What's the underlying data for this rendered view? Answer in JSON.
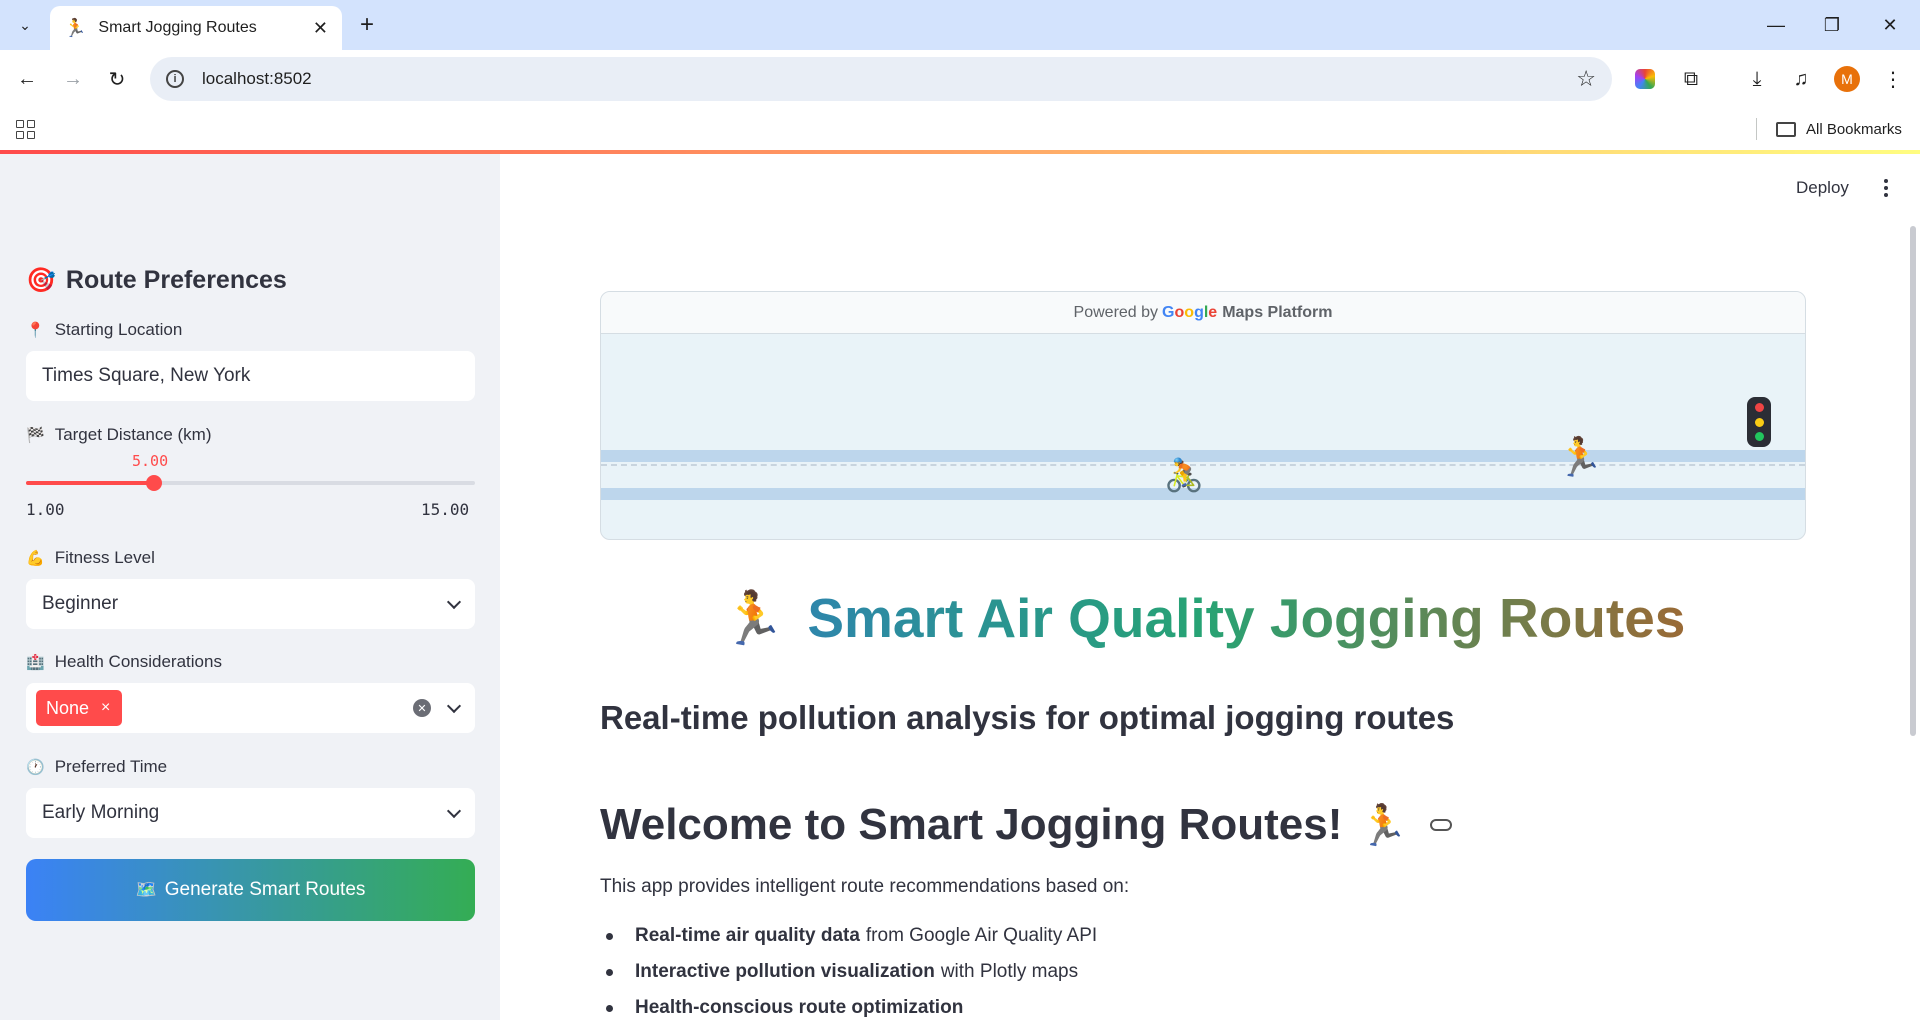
{
  "browser": {
    "tab_title": "Smart Jogging Routes",
    "tab_favicon": "🏃",
    "url": "localhost:8502",
    "profile_initial": "M",
    "bookmarks_label": "All Bookmarks"
  },
  "header": {
    "deploy_label": "Deploy"
  },
  "sidebar": {
    "title": "Route Preferences",
    "title_emoji": "🎯",
    "starting_location": {
      "label": "Starting Location",
      "emoji": "📍",
      "value": "Times Square, New York"
    },
    "target_distance": {
      "label": "Target Distance (km)",
      "emoji": "🏁",
      "value": "5.00",
      "min": "1.00",
      "max": "15.00",
      "fraction": 0.2857
    },
    "fitness_level": {
      "label": "Fitness Level",
      "emoji": "💪",
      "value": "Beginner"
    },
    "health_considerations": {
      "label": "Health Considerations",
      "emoji": "🏥",
      "chip": "None",
      "chip_remove": "×"
    },
    "preferred_time": {
      "label": "Preferred Time",
      "emoji": "🕐",
      "value": "Early Morning"
    },
    "generate_button": {
      "emoji": "🗺️",
      "label": "Generate Smart Routes"
    }
  },
  "banner": {
    "powered_by": "Powered by",
    "google_letters": [
      "G",
      "o",
      "o",
      "g",
      "l",
      "e"
    ],
    "google_colors": [
      "#4285F4",
      "#EA4335",
      "#FBBC05",
      "#4285F4",
      "#34A853",
      "#EA4335"
    ],
    "maps_platform": "Maps Platform",
    "bike_emoji": "🚴",
    "runner_emoji": "🏃",
    "traffic_light_colors": [
      "#ef4444",
      "#facc15",
      "#22c55e"
    ]
  },
  "main": {
    "title_emoji": "🏃",
    "title": "Smart Air Quality Jogging Routes",
    "subtitle": "Real-time pollution analysis for optimal jogging routes",
    "welcome": "Welcome to Smart Jogging Routes!",
    "welcome_emoji": "🏃",
    "intro": "This app provides intelligent route recommendations based on:",
    "features": [
      {
        "bold": "Real-time air quality data",
        "rest": "from Google Air Quality API"
      },
      {
        "bold": "Interactive pollution visualization",
        "rest": "with Plotly maps"
      },
      {
        "bold": "Health-conscious route optimization",
        "rest": ""
      }
    ]
  },
  "colors": {
    "accent": "#ff4b4b",
    "sidebar_bg": "#f0f2f6",
    "button_gradient_start": "#3b82f6",
    "button_gradient_end": "#34ad54"
  }
}
